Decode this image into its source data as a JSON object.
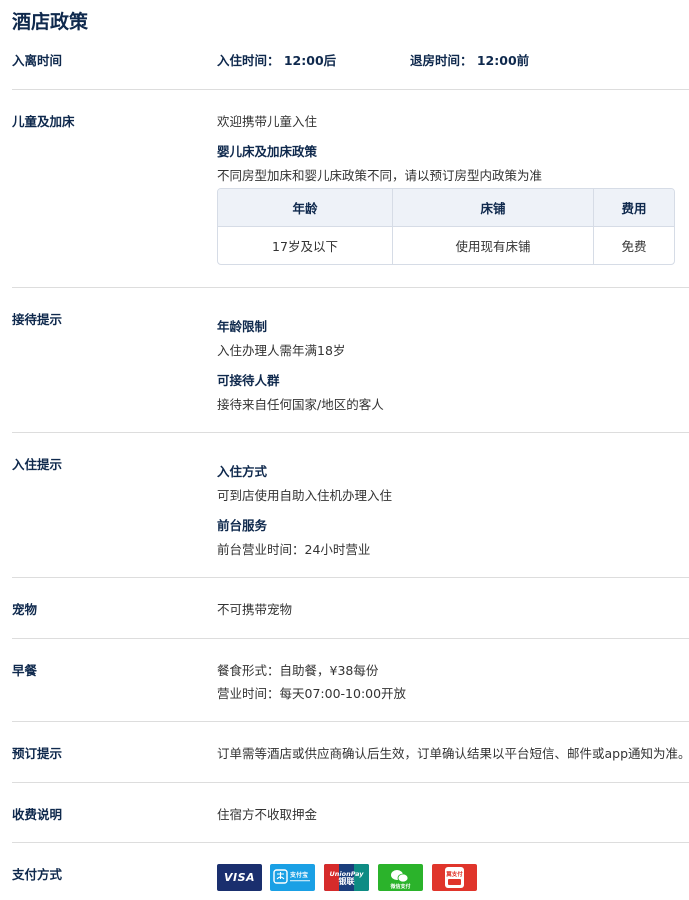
{
  "title": "酒店政策",
  "checkin_time": {
    "label": "入离时间",
    "checkin": "入住时间： 12:00后",
    "checkout": "退房时间： 12:00前"
  },
  "children": {
    "label": "儿童及加床",
    "welcome": "欢迎携带儿童入住",
    "sub_title": "婴儿床及加床政策",
    "desc": "不同房型加床和婴儿床政策不同，请以预订房型内政策为准",
    "table": {
      "headers": [
        "年龄",
        "床铺",
        "费用"
      ],
      "rows": [
        [
          "17岁及以下",
          "使用现有床铺",
          "免费"
        ]
      ]
    }
  },
  "reception": {
    "label": "接待提示",
    "age_title": "年龄限制",
    "age_text": "入住办理人需年满18岁",
    "guests_title": "可接待人群",
    "guests_text": "接待来自任何国家/地区的客人"
  },
  "checkin_tips": {
    "label": "入住提示",
    "method_title": "入住方式",
    "method_text": "可到店使用自助入住机办理入住",
    "desk_title": "前台服务",
    "desk_text": "前台营业时间：24小时营业"
  },
  "pets": {
    "label": "宠物",
    "text": "不可携带宠物"
  },
  "breakfast": {
    "label": "早餐",
    "style": "餐食形式：自助餐，¥38每份",
    "hours": "营业时间：每天07:00-10:00开放"
  },
  "booking": {
    "label": "预订提示",
    "text": "订单需等酒店或供应商确认后生效，订单确认结果以平台短信、邮件或app通知为准。"
  },
  "fees": {
    "label": "收费说明",
    "text": "住宿方不收取押金"
  },
  "payment": {
    "label": "支付方式",
    "methods": [
      {
        "name": "visa",
        "text": "VISA",
        "icon": "visa-icon",
        "color": "#1a2f6e"
      },
      {
        "name": "alipay",
        "text": "支付宝",
        "icon": "alipay-icon",
        "color": "#1aa0e5"
      },
      {
        "name": "unionpay",
        "text": "UnionPay",
        "cn": "银联",
        "icon": "unionpay-icon",
        "color": "#1a3e7c"
      },
      {
        "name": "wechat",
        "text": "微信支付",
        "icon": "wechat-pay-icon",
        "color": "#2bb32b"
      },
      {
        "name": "bestpay",
        "text": "翼支付",
        "icon": "bestpay-icon",
        "color": "#e0352b"
      }
    ]
  }
}
